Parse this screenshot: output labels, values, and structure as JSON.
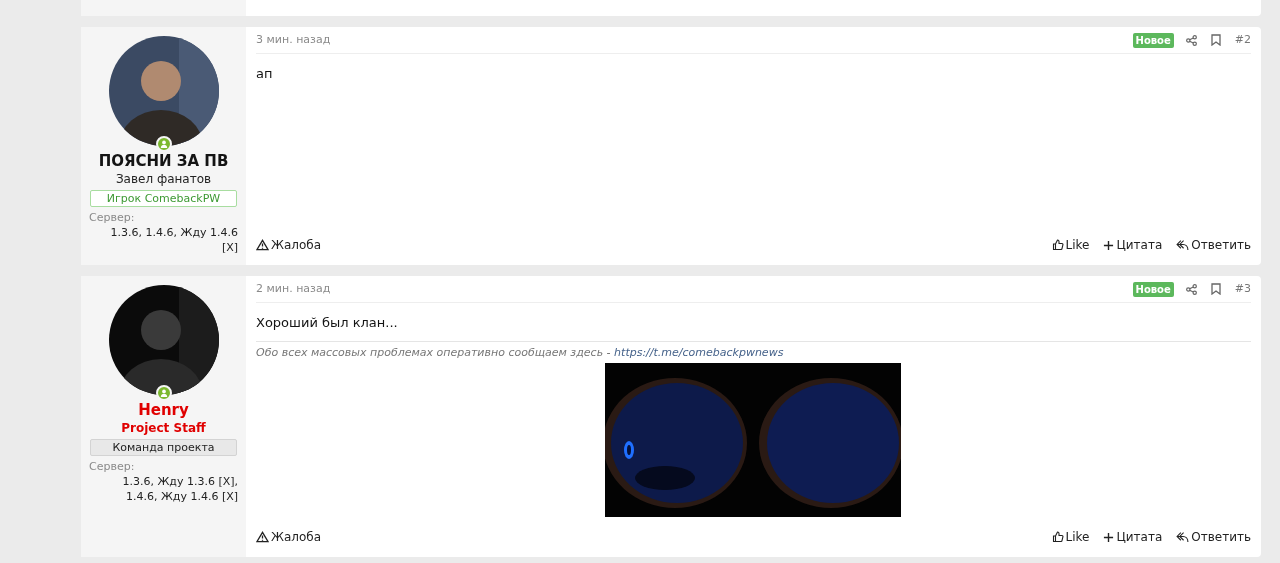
{
  "posts": [
    {
      "user": {
        "name": "ПОЯСНИ ЗА ПВ",
        "kind": "member",
        "title": "Завел фанатов",
        "banner": "Игрок ComebackPW",
        "server_label": "Сервер:",
        "server": "1.3.6, 1.4.6, Жду 1.4.6 [X]",
        "online": true
      },
      "time": "3 мин. назад",
      "new": true,
      "badge": "Новое",
      "number": "#2",
      "body": "ап",
      "report": "Жалоба",
      "actions": [
        "Like",
        "Цитата",
        "Ответить"
      ]
    },
    {
      "user": {
        "name": "Henry",
        "kind": "staff",
        "title": "Project Staff",
        "banner": "Команда проекта",
        "server_label": "Сервер:",
        "server": "1.3.6, Жду 1.3.6 [X], 1.4.6, Жду 1.4.6 [X]",
        "online": true
      },
      "time": "2 мин. назад",
      "new": true,
      "badge": "Новое",
      "number": "#3",
      "body": "Хороший был клан...",
      "signature": {
        "text": "Обо всех массовых проблемах оперативно сообщаем здесь - ",
        "link": "https://t.me/comebackpwnews"
      },
      "report": "Жалоба",
      "actions": [
        "Like",
        "Цитата",
        "Ответить"
      ]
    }
  ]
}
